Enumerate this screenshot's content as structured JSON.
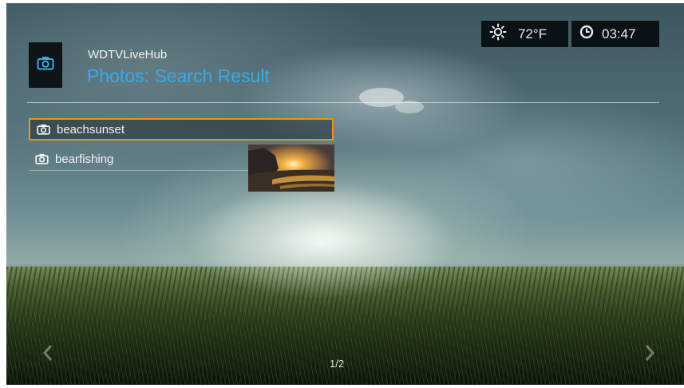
{
  "header": {
    "app_name": "WDTVLiveHub",
    "title": "Photos: Search Result",
    "app_icon": "camera-icon"
  },
  "status": {
    "weather_icon": "sun-icon",
    "temperature": "72°F",
    "clock_icon": "clock-icon",
    "time": "03:47"
  },
  "results": {
    "items": [
      {
        "label": "beachsunset",
        "icon": "camera-icon",
        "selected": true
      },
      {
        "label": "bearfishing",
        "icon": "camera-icon",
        "selected": false
      }
    ]
  },
  "pager": {
    "page": "1/2"
  },
  "colors": {
    "accent_blue": "#3aa9ea",
    "selection_orange": "#e69420",
    "panel_dark": "#0b1216"
  }
}
